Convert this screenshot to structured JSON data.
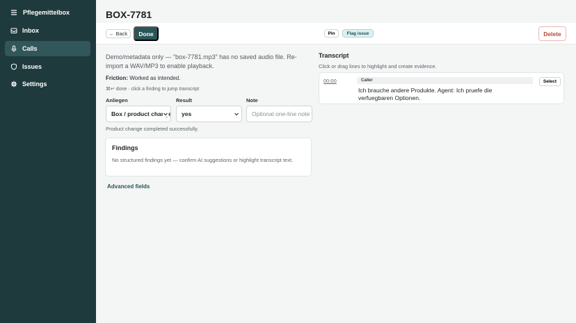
{
  "sidebar": {
    "brand": "Pflegemittelbox",
    "items": [
      {
        "label": "Inbox",
        "icon": "inbox-icon"
      },
      {
        "label": "Calls",
        "icon": "microphone-icon",
        "active": true
      },
      {
        "label": "Issues",
        "icon": "shield-icon"
      },
      {
        "label": "Settings",
        "icon": "gear-icon"
      }
    ]
  },
  "header": {
    "title": "BOX-7781"
  },
  "toolbar": {
    "back_label": "← Back",
    "done_label": "Done",
    "pin_label": "Pin",
    "flag_label": "Flag issue",
    "delete_label": "Delete"
  },
  "main": {
    "demo_notice": "Demo/metadata only — “box-7781.mp3” has no saved audio file. Re-import a WAV/MP3 to enable playback.",
    "friction_label": "Friction:",
    "friction_value": "Worked as intended.",
    "shortcut_hint": "⌘↵ done · click a finding to jump transcript",
    "fields": {
      "anliegen_label": "Anliegen",
      "anliegen_value": "Box / product change",
      "result_label": "Result",
      "result_value": "yes",
      "note_label": "Note",
      "note_placeholder": "Optional one-line note"
    },
    "success_text": "Product change completed successfully.",
    "findings": {
      "title": "Findings",
      "empty_text": "No structured findings yet — confirm AI suggestions or highlight transcript text."
    },
    "advanced_label": "Advanced fields"
  },
  "transcript": {
    "title": "Transcript",
    "hint": "Click or drag lines to highlight and create evidence.",
    "lines": [
      {
        "time": "00:00",
        "speaker": "Caller",
        "text": "Ich brauche andere Produkte. Agent: Ich pruefe die verfuegbaren Optionen.",
        "select_label": "Select"
      }
    ]
  },
  "colors": {
    "sidebar_bg": "#1f3a3d",
    "accent": "#2a5558",
    "delete": "#b6463a"
  }
}
